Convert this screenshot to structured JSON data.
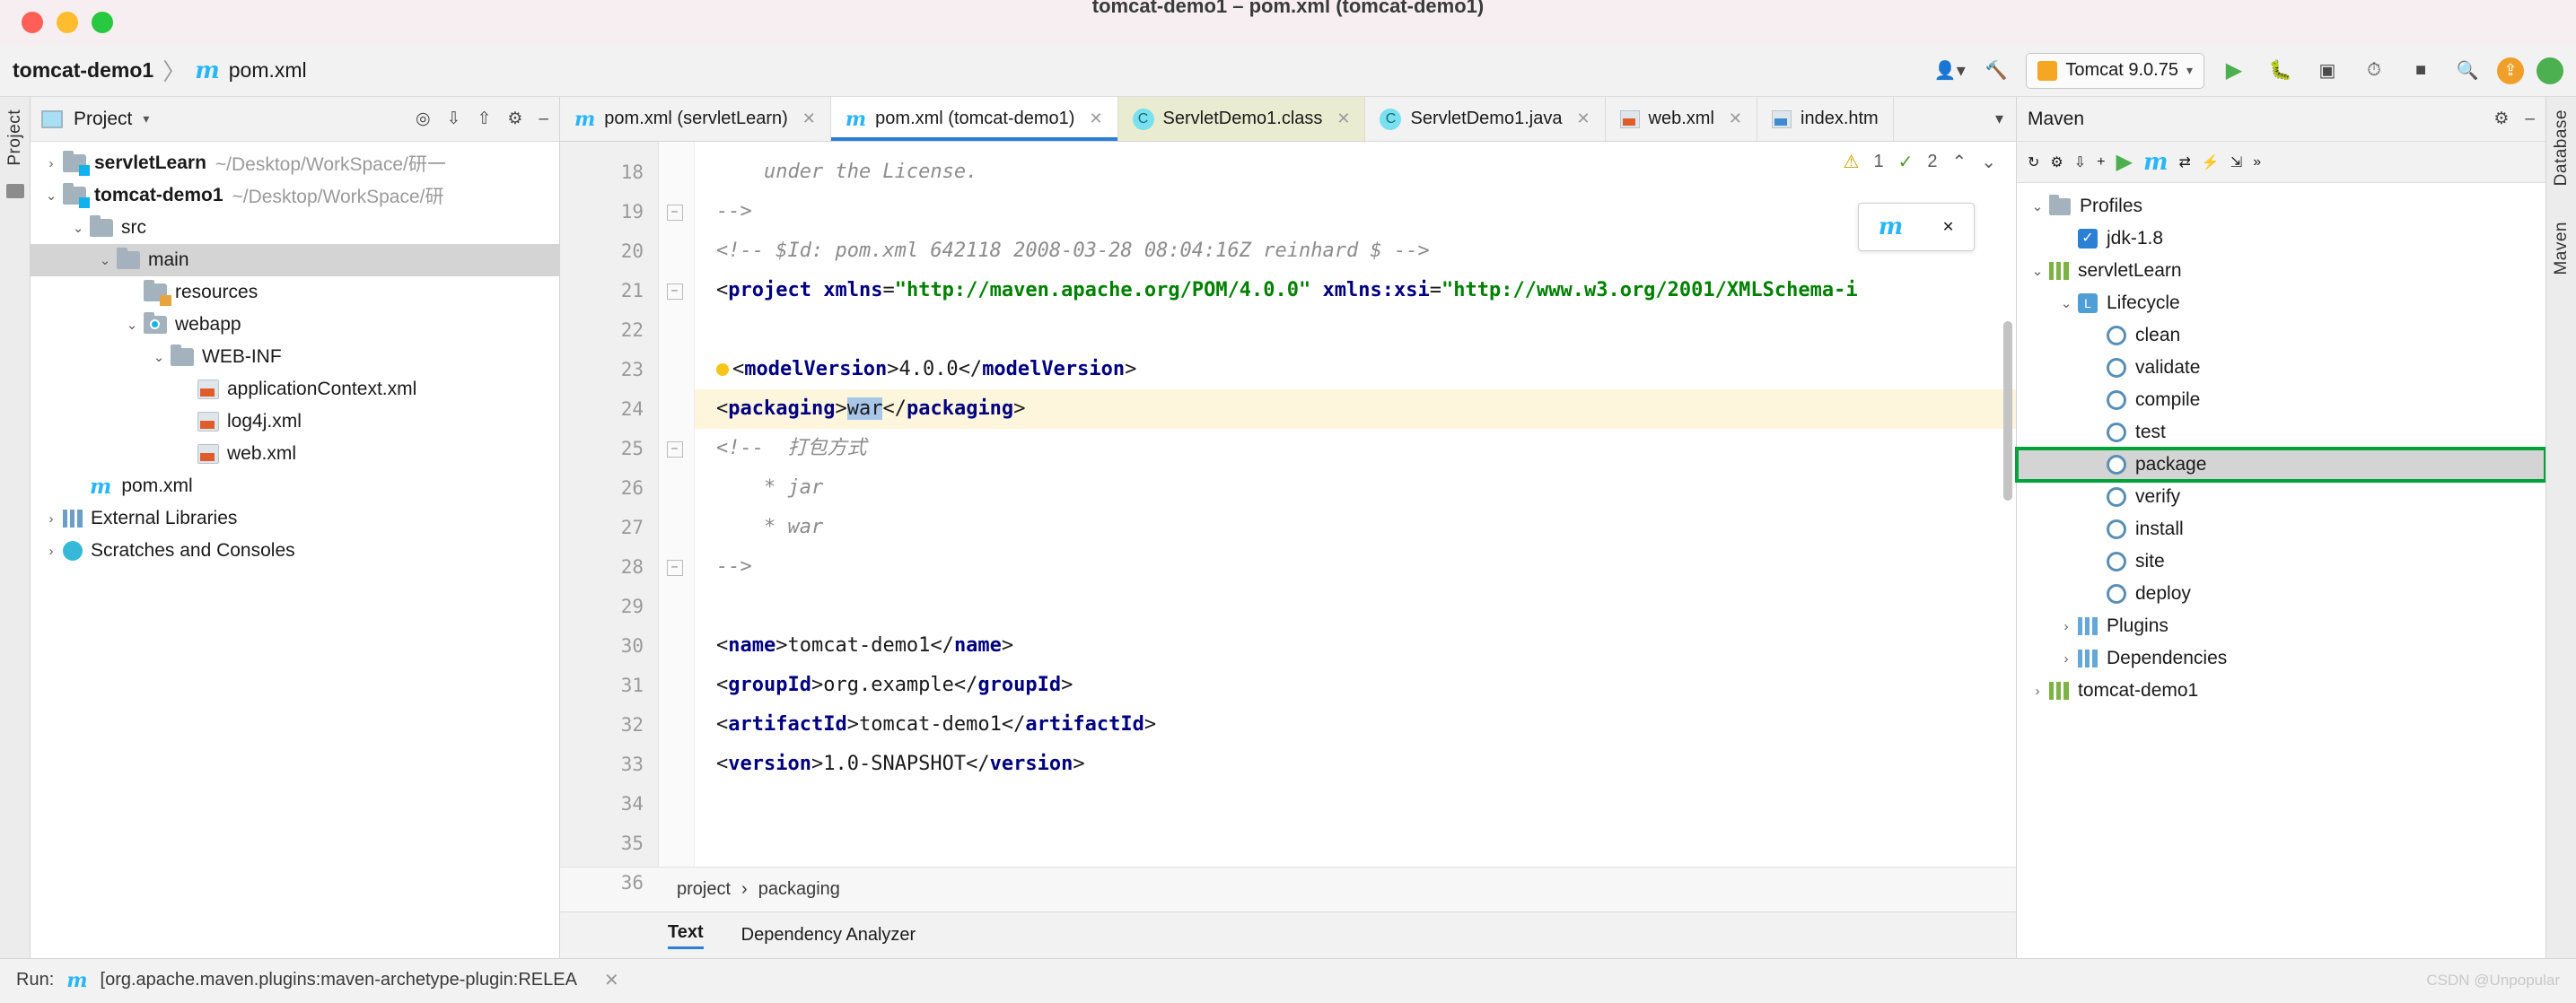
{
  "window": {
    "title": "tomcat-demo1 – pom.xml (tomcat-demo1)"
  },
  "breadcrumb": {
    "project": "tomcat-demo1",
    "separator": "〉",
    "maven_icon": "m",
    "file": "pom.xml"
  },
  "toolbar": {
    "user_icon": "user-icon",
    "hammer_icon": "build-icon",
    "run_config": "Tomcat 9.0.75",
    "run_icon": "run-icon",
    "debug_icon": "debug-icon",
    "coverage_icon": "coverage-icon",
    "profile_icon": "profiler-icon",
    "stop_icon": "stop-icon",
    "search_icon": "search-icon",
    "update_icon": "update-icon",
    "avatar_icon": "avatar-icon",
    "accent": "#2b7fd4"
  },
  "left_rail": {
    "label": "Project"
  },
  "right_rail": {
    "labels": [
      "Database",
      "Maven"
    ]
  },
  "project_panel": {
    "title": "Project",
    "icons": [
      "locate-icon",
      "collapse-all-icon",
      "expand-icon",
      "settings-gear-icon",
      "minimize-icon"
    ],
    "tree": [
      {
        "indent": 0,
        "twisty": "›",
        "icon": "module-folder",
        "label": "servletLearn",
        "bold": true,
        "path": "~/Desktop/WorkSpace/研一",
        "selected": false
      },
      {
        "indent": 0,
        "twisty": "⌄",
        "icon": "module-folder",
        "label": "tomcat-demo1",
        "bold": true,
        "path": "~/Desktop/WorkSpace/研",
        "selected": false
      },
      {
        "indent": 1,
        "twisty": "⌄",
        "icon": "folder",
        "label": "src",
        "bold": false,
        "path": "",
        "selected": false
      },
      {
        "indent": 2,
        "twisty": "⌄",
        "icon": "folder",
        "label": "main",
        "bold": false,
        "path": "",
        "selected": true
      },
      {
        "indent": 3,
        "twisty": "",
        "icon": "resources-folder",
        "label": "resources",
        "bold": false,
        "path": "",
        "selected": false
      },
      {
        "indent": 3,
        "twisty": "⌄",
        "icon": "webapp-folder",
        "label": "webapp",
        "bold": false,
        "path": "",
        "selected": false
      },
      {
        "indent": 4,
        "twisty": "⌄",
        "icon": "folder",
        "label": "WEB-INF",
        "bold": false,
        "path": "",
        "selected": false
      },
      {
        "indent": 5,
        "twisty": "",
        "icon": "xml-file",
        "label": "applicationContext.xml",
        "bold": false,
        "path": "",
        "selected": false
      },
      {
        "indent": 5,
        "twisty": "",
        "icon": "xml-file",
        "label": "log4j.xml",
        "bold": false,
        "path": "",
        "selected": false
      },
      {
        "indent": 5,
        "twisty": "",
        "icon": "xml-file",
        "label": "web.xml",
        "bold": false,
        "path": "",
        "selected": false
      },
      {
        "indent": 1,
        "twisty": "",
        "icon": "maven-file",
        "label": "pom.xml",
        "bold": false,
        "path": "",
        "selected": false
      },
      {
        "indent": 0,
        "twisty": "›",
        "icon": "library-icon",
        "label": "External Libraries",
        "bold": false,
        "path": "",
        "selected": false
      },
      {
        "indent": 0,
        "twisty": "›",
        "icon": "scratch-icon",
        "label": "Scratches and Consoles",
        "bold": false,
        "path": "",
        "selected": false
      }
    ]
  },
  "editor": {
    "tabs": [
      {
        "label": "pom.xml (servletLearn)",
        "icon": "maven-icon",
        "state": "normal",
        "closable": true
      },
      {
        "label": "pom.xml (tomcat-demo1)",
        "icon": "maven-icon",
        "state": "active",
        "closable": true
      },
      {
        "label": "ServletDemo1.class",
        "icon": "class-icon",
        "state": "class",
        "closable": true
      },
      {
        "label": "ServletDemo1.java",
        "icon": "class-icon",
        "state": "normal",
        "closable": true
      },
      {
        "label": "web.xml",
        "icon": "xml-icon",
        "state": "normal",
        "closable": true
      },
      {
        "label": "index.htm",
        "icon": "html-icon",
        "state": "normal",
        "closable": false
      }
    ],
    "tab_overflow_icon": "chevron-down-icon",
    "inspection": {
      "warning_count": "1",
      "ok_count": "2",
      "warning_icon": "warning-triangle-icon",
      "ok_icon": "checkmark-icon",
      "up_icon": "chevron-up-icon",
      "down_icon": "chevron-down-icon"
    },
    "float_panel": {
      "maven_icon": "m",
      "refresh_icon": "refresh-icon",
      "close_icon": "close-icon"
    },
    "line_start": 18,
    "lines": [
      {
        "n": 18,
        "fold": "",
        "segments": [
          {
            "t": "    under the License.",
            "c": "cmt"
          }
        ]
      },
      {
        "n": 19,
        "fold": "−",
        "segments": [
          {
            "t": "-->",
            "c": "cmt"
          }
        ]
      },
      {
        "n": 20,
        "fold": "",
        "segments": [
          {
            "t": "<!-- $Id: pom.xml 642118 2008-03-28 08:04:16Z reinhard $ -->",
            "c": "cmt"
          }
        ]
      },
      {
        "n": 21,
        "fold": "−",
        "segments": [
          {
            "t": "<",
            "c": "txt"
          },
          {
            "t": "project",
            "c": "tag"
          },
          {
            "t": " ",
            "c": "txt"
          },
          {
            "t": "xmlns",
            "c": "attr"
          },
          {
            "t": "=",
            "c": "txt"
          },
          {
            "t": "\"http://maven.apache.org/POM/4.0.0\"",
            "c": "str"
          },
          {
            "t": " ",
            "c": "txt"
          },
          {
            "t": "xmlns:xsi",
            "c": "attr"
          },
          {
            "t": "=",
            "c": "txt"
          },
          {
            "t": "\"http://www.w3.org/2001/XMLSchema-i",
            "c": "str"
          }
        ]
      },
      {
        "n": 22,
        "fold": "",
        "segments": [
          {
            "t": "",
            "c": "txt"
          }
        ]
      },
      {
        "n": 23,
        "fold": "",
        "bulb": true,
        "segments": [
          {
            "t": "<",
            "c": "txt"
          },
          {
            "t": "modelVersion",
            "c": "tag"
          },
          {
            "t": ">",
            "c": "txt"
          },
          {
            "t": "4.0.0",
            "c": "txt"
          },
          {
            "t": "</",
            "c": "txt"
          },
          {
            "t": "modelVersion",
            "c": "tag"
          },
          {
            "t": ">",
            "c": "txt"
          }
        ]
      },
      {
        "n": 24,
        "fold": "",
        "highlight": true,
        "segments": [
          {
            "t": "<",
            "c": "txt"
          },
          {
            "t": "packaging",
            "c": "tag"
          },
          {
            "t": ">",
            "c": "txt"
          },
          {
            "t": "war",
            "c": "selbg"
          },
          {
            "t": "</",
            "c": "txt"
          },
          {
            "t": "packaging",
            "c": "tag"
          },
          {
            "t": ">",
            "c": "txt"
          }
        ]
      },
      {
        "n": 25,
        "fold": "−",
        "segments": [
          {
            "t": "<!--  打包方式",
            "c": "cmt"
          }
        ]
      },
      {
        "n": 26,
        "fold": "",
        "segments": [
          {
            "t": "    * jar",
            "c": "cmt"
          }
        ]
      },
      {
        "n": 27,
        "fold": "",
        "segments": [
          {
            "t": "    * war",
            "c": "cmt"
          }
        ]
      },
      {
        "n": 28,
        "fold": "−",
        "segments": [
          {
            "t": "-->",
            "c": "cmt"
          }
        ]
      },
      {
        "n": 29,
        "fold": "",
        "segments": [
          {
            "t": "",
            "c": "txt"
          }
        ]
      },
      {
        "n": 30,
        "fold": "",
        "segments": [
          {
            "t": "<",
            "c": "txt"
          },
          {
            "t": "name",
            "c": "tag"
          },
          {
            "t": ">",
            "c": "txt"
          },
          {
            "t": "tomcat-demo1",
            "c": "txt"
          },
          {
            "t": "</",
            "c": "txt"
          },
          {
            "t": "name",
            "c": "tag"
          },
          {
            "t": ">",
            "c": "txt"
          }
        ]
      },
      {
        "n": 31,
        "fold": "",
        "segments": [
          {
            "t": "<",
            "c": "txt"
          },
          {
            "t": "groupId",
            "c": "tag"
          },
          {
            "t": ">",
            "c": "txt"
          },
          {
            "t": "org.example",
            "c": "txt"
          },
          {
            "t": "</",
            "c": "txt"
          },
          {
            "t": "groupId",
            "c": "tag"
          },
          {
            "t": ">",
            "c": "txt"
          }
        ]
      },
      {
        "n": 32,
        "fold": "",
        "segments": [
          {
            "t": "<",
            "c": "txt"
          },
          {
            "t": "artifactId",
            "c": "tag"
          },
          {
            "t": ">",
            "c": "txt"
          },
          {
            "t": "tomcat-demo1",
            "c": "txt"
          },
          {
            "t": "</",
            "c": "txt"
          },
          {
            "t": "artifactId",
            "c": "tag"
          },
          {
            "t": ">",
            "c": "txt"
          }
        ]
      },
      {
        "n": 33,
        "fold": "",
        "segments": [
          {
            "t": "<",
            "c": "txt"
          },
          {
            "t": "version",
            "c": "tag"
          },
          {
            "t": ">",
            "c": "txt"
          },
          {
            "t": "1.0-SNAPSHOT",
            "c": "txt"
          },
          {
            "t": "</",
            "c": "txt"
          },
          {
            "t": "version",
            "c": "tag"
          },
          {
            "t": ">",
            "c": "txt"
          }
        ]
      },
      {
        "n": 34,
        "fold": "",
        "segments": [
          {
            "t": "",
            "c": "txt"
          }
        ]
      },
      {
        "n": 35,
        "fold": "",
        "segments": [
          {
            "t": "",
            "c": "txt"
          }
        ]
      },
      {
        "n": 36,
        "fold": "",
        "segments": [
          {
            "t": "",
            "c": "txt"
          }
        ]
      }
    ],
    "breadcrumb": [
      "project",
      "packaging"
    ],
    "breadcrumb_separator": "›",
    "bottom_tabs": [
      {
        "label": "Text",
        "active": true
      },
      {
        "label": "Dependency Analyzer",
        "active": false
      }
    ]
  },
  "maven_panel": {
    "title": "Maven",
    "icons": [
      "reload-icon",
      "generate-sources-icon",
      "download-sources-icon",
      "add-icon",
      "run-icon",
      "maven-icon",
      "toggle-icon",
      "execute-icon",
      "expand-icon",
      "more-icon"
    ],
    "header_icons": [
      "settings-gear-icon",
      "minimize-icon"
    ],
    "tree": [
      {
        "indent": 0,
        "twisty": "⌄",
        "icon": "folder",
        "label": "Profiles",
        "selected": false
      },
      {
        "indent": 1,
        "twisty": "",
        "icon": "checkbox",
        "label": "jdk-1.8",
        "selected": false
      },
      {
        "indent": 0,
        "twisty": "⌄",
        "icon": "maven-project",
        "label": "servletLearn",
        "selected": false
      },
      {
        "indent": 1,
        "twisty": "⌄",
        "icon": "lifecycle",
        "label": "Lifecycle",
        "selected": false
      },
      {
        "indent": 2,
        "twisty": "",
        "icon": "goal",
        "label": "clean",
        "selected": false
      },
      {
        "indent": 2,
        "twisty": "",
        "icon": "goal",
        "label": "validate",
        "selected": false
      },
      {
        "indent": 2,
        "twisty": "",
        "icon": "goal",
        "label": "compile",
        "selected": false
      },
      {
        "indent": 2,
        "twisty": "",
        "icon": "goal",
        "label": "test",
        "selected": false
      },
      {
        "indent": 2,
        "twisty": "",
        "icon": "goal",
        "label": "package",
        "selected": true
      },
      {
        "indent": 2,
        "twisty": "",
        "icon": "goal",
        "label": "verify",
        "selected": false
      },
      {
        "indent": 2,
        "twisty": "",
        "icon": "goal",
        "label": "install",
        "selected": false
      },
      {
        "indent": 2,
        "twisty": "",
        "icon": "goal",
        "label": "site",
        "selected": false
      },
      {
        "indent": 2,
        "twisty": "",
        "icon": "goal",
        "label": "deploy",
        "selected": false
      },
      {
        "indent": 1,
        "twisty": "›",
        "icon": "plugins",
        "label": "Plugins",
        "selected": false
      },
      {
        "indent": 1,
        "twisty": "›",
        "icon": "dependencies",
        "label": "Dependencies",
        "selected": false
      },
      {
        "indent": 0,
        "twisty": "›",
        "icon": "maven-project",
        "label": "tomcat-demo1",
        "selected": false
      }
    ],
    "highlight_color": "#00a23a"
  },
  "run_bar": {
    "label": "Run:",
    "icon": "maven-icon",
    "task": "[org.apache.maven.plugins:maven-archetype-plugin:RELEA",
    "close_icon": "close-icon",
    "watermark": "CSDN @Unpopular"
  }
}
